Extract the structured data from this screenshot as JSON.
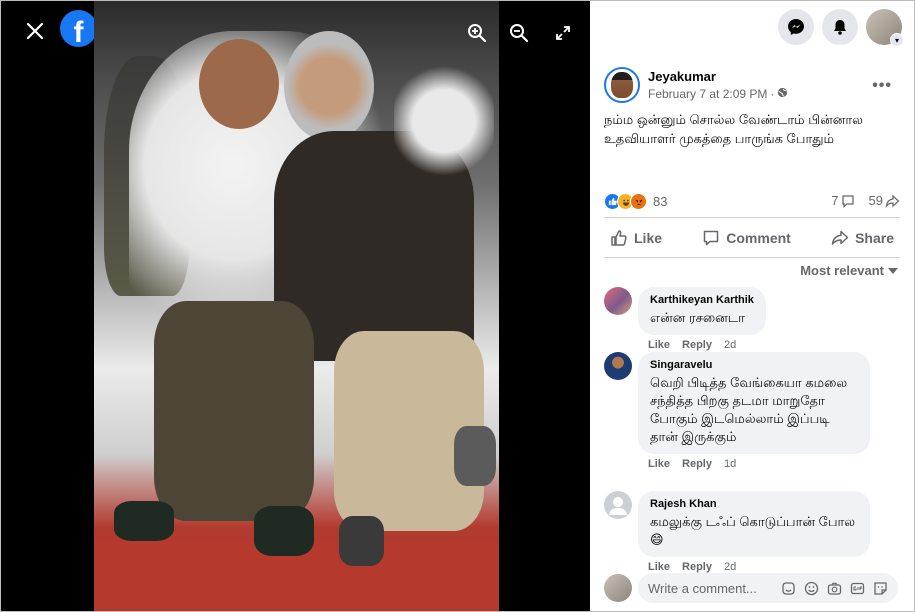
{
  "viewer": {
    "close_icon": "close-icon",
    "logo": "f",
    "zoom_in_icon": "zoom-in-icon",
    "zoom_out_icon": "zoom-out-icon",
    "fullscreen_icon": "fullscreen-icon"
  },
  "topbar": {
    "messenger_icon": "messenger-icon",
    "notifications_icon": "bell-icon",
    "account_chevron": "▾"
  },
  "post": {
    "author": "Jeyakumar",
    "date": "February 7 at 2:09 PM",
    "separator": "·",
    "audience_icon": "globe-icon",
    "text": "நம்ம ஒன்னும் சொல்ல வேண்டாம் பின்னால உதவியாளர் முகத்தை பாருங்க போதும்",
    "reaction_count": "83",
    "comment_count": "7",
    "share_count": "59"
  },
  "actions": {
    "like": "Like",
    "comment": "Comment",
    "share": "Share"
  },
  "sort_label": "Most relevant",
  "comments": [
    {
      "name": "Karthikeyan Karthik",
      "text": "என்ன ரசனைடா",
      "like": "Like",
      "reply": "Reply",
      "time": "2d"
    },
    {
      "name": "Singaravelu",
      "text": "வெறி பிடித்த வேங்கையா கமலை சந்தித்த பிறகு தடமா மாறுதோ போகும் இடமெல்லாம் இப்படி தான் இருக்கும்",
      "like": "Like",
      "reply": "Reply",
      "time": "1d"
    },
    {
      "name": "Rajesh Khan",
      "text": "கமலுக்கு டஃப் கொடுப்பான் போல 😄",
      "like": "Like",
      "reply": "Reply",
      "time": "2d"
    }
  ],
  "write_comment": {
    "placeholder": "Write a comment..."
  },
  "colors": {
    "brand": "#1877f2",
    "bubble": "#f0f2f5",
    "muted": "#65676b"
  }
}
